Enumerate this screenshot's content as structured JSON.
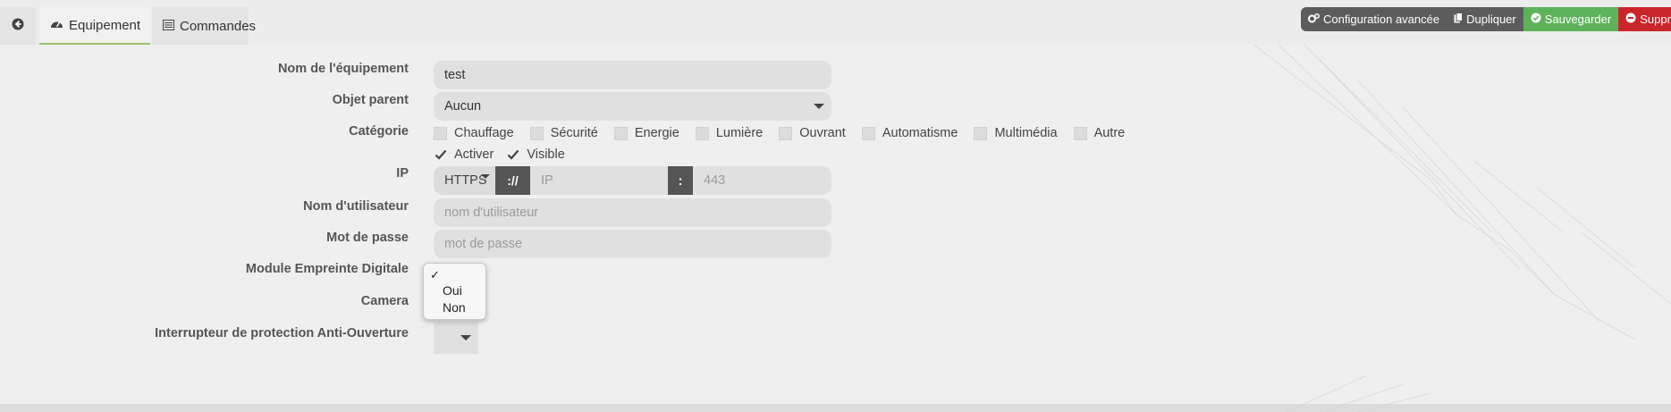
{
  "tabs": {
    "equipement": "Equipement",
    "commandes": "Commandes"
  },
  "actions": {
    "config": "Configuration avancée",
    "dupliquer": "Dupliquer",
    "sauvegarder": "Sauvegarder",
    "supprimer": "Supprimer"
  },
  "form": {
    "nom_label": "Nom de l'équipement",
    "nom_value": "test",
    "objet_label": "Objet parent",
    "objet_value": "Aucun",
    "categorie_label": "Catégorie",
    "categories": [
      "Chauffage",
      "Sécurité",
      "Energie",
      "Lumière",
      "Ouvrant",
      "Automatisme",
      "Multimédia",
      "Autre"
    ],
    "activer": "Activer",
    "visible": "Visible",
    "ip_label": "IP",
    "ip_protocol": "HTTPS",
    "ip_separator": "://",
    "ip_placeholder": "IP",
    "ip_colon": ":",
    "port_placeholder": "443",
    "user_label": "Nom d'utilisateur",
    "user_placeholder": "nom d'utilisateur",
    "pass_label": "Mot de passe",
    "pass_placeholder": "mot de passe",
    "empreinte_label": "Module Empreinte Digitale",
    "camera_label": "Camera",
    "interrupteur_label": "Interrupteur de protection Anti-Ouverture"
  },
  "dropdown": {
    "check": "✓",
    "options": [
      "Oui",
      "Non"
    ]
  },
  "colors": {
    "save": "#5eb35a",
    "delete": "#c9262c",
    "dark": "#5c5c5c",
    "tab_active_underline": "#9dc06a"
  }
}
